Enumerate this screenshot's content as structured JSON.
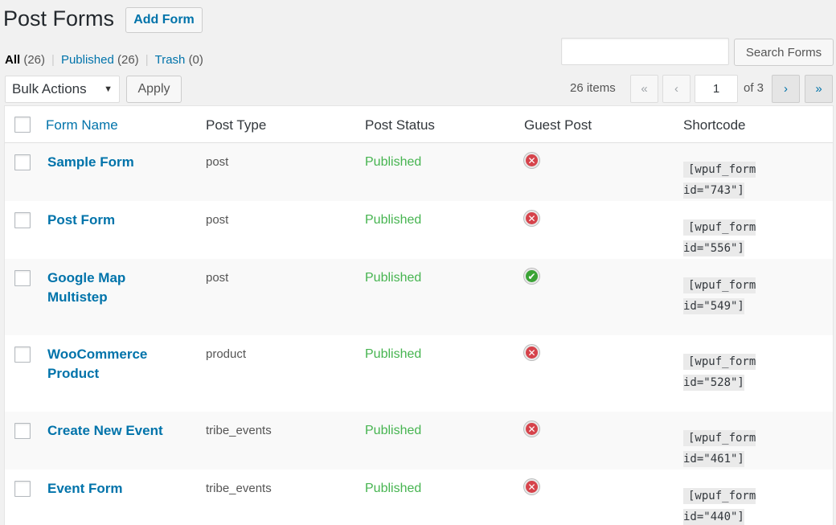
{
  "header": {
    "title": "Post Forms",
    "add_label": "Add Form"
  },
  "filters": [
    {
      "label": "All",
      "count": "(26)",
      "current": true
    },
    {
      "label": "Published",
      "count": "(26)",
      "current": false
    },
    {
      "label": "Trash",
      "count": "(0)",
      "current": false
    }
  ],
  "search": {
    "value": "",
    "button_label": "Search Forms"
  },
  "bulk": {
    "selected": "Bulk Actions",
    "apply_label": "Apply"
  },
  "pagination": {
    "items": "26 items",
    "first": "«",
    "prev": "‹",
    "current": "1",
    "of": "of 3",
    "next": "›",
    "last": "»"
  },
  "table": {
    "columns": {
      "name": "Form Name",
      "type": "Post Type",
      "status": "Post Status",
      "guest": "Guest Post",
      "shortcode": "Shortcode"
    },
    "rows": [
      {
        "name": "Sample Form",
        "type": "post",
        "status": "Published",
        "guest": false,
        "sc1": "[wpuf_form",
        "sc2": "id=\"743\"]"
      },
      {
        "name": "Post Form",
        "type": "post",
        "status": "Published",
        "guest": false,
        "sc1": "[wpuf_form",
        "sc2": "id=\"556\"]"
      },
      {
        "name": "Google Map Multistep",
        "type": "post",
        "status": "Published",
        "guest": true,
        "sc1": "[wpuf_form",
        "sc2": "id=\"549\"]"
      },
      {
        "name": "WooCommerce Product",
        "type": "product",
        "status": "Published",
        "guest": false,
        "sc1": "[wpuf_form",
        "sc2": "id=\"528\"]"
      },
      {
        "name": "Create New Event",
        "type": "tribe_events",
        "status": "Published",
        "guest": false,
        "sc1": "[wpuf_form",
        "sc2": "id=\"461\"]"
      },
      {
        "name": "Event Form",
        "type": "tribe_events",
        "status": "Published",
        "guest": false,
        "sc1": "[wpuf_form",
        "sc2": "id=\"440\"]"
      }
    ]
  }
}
